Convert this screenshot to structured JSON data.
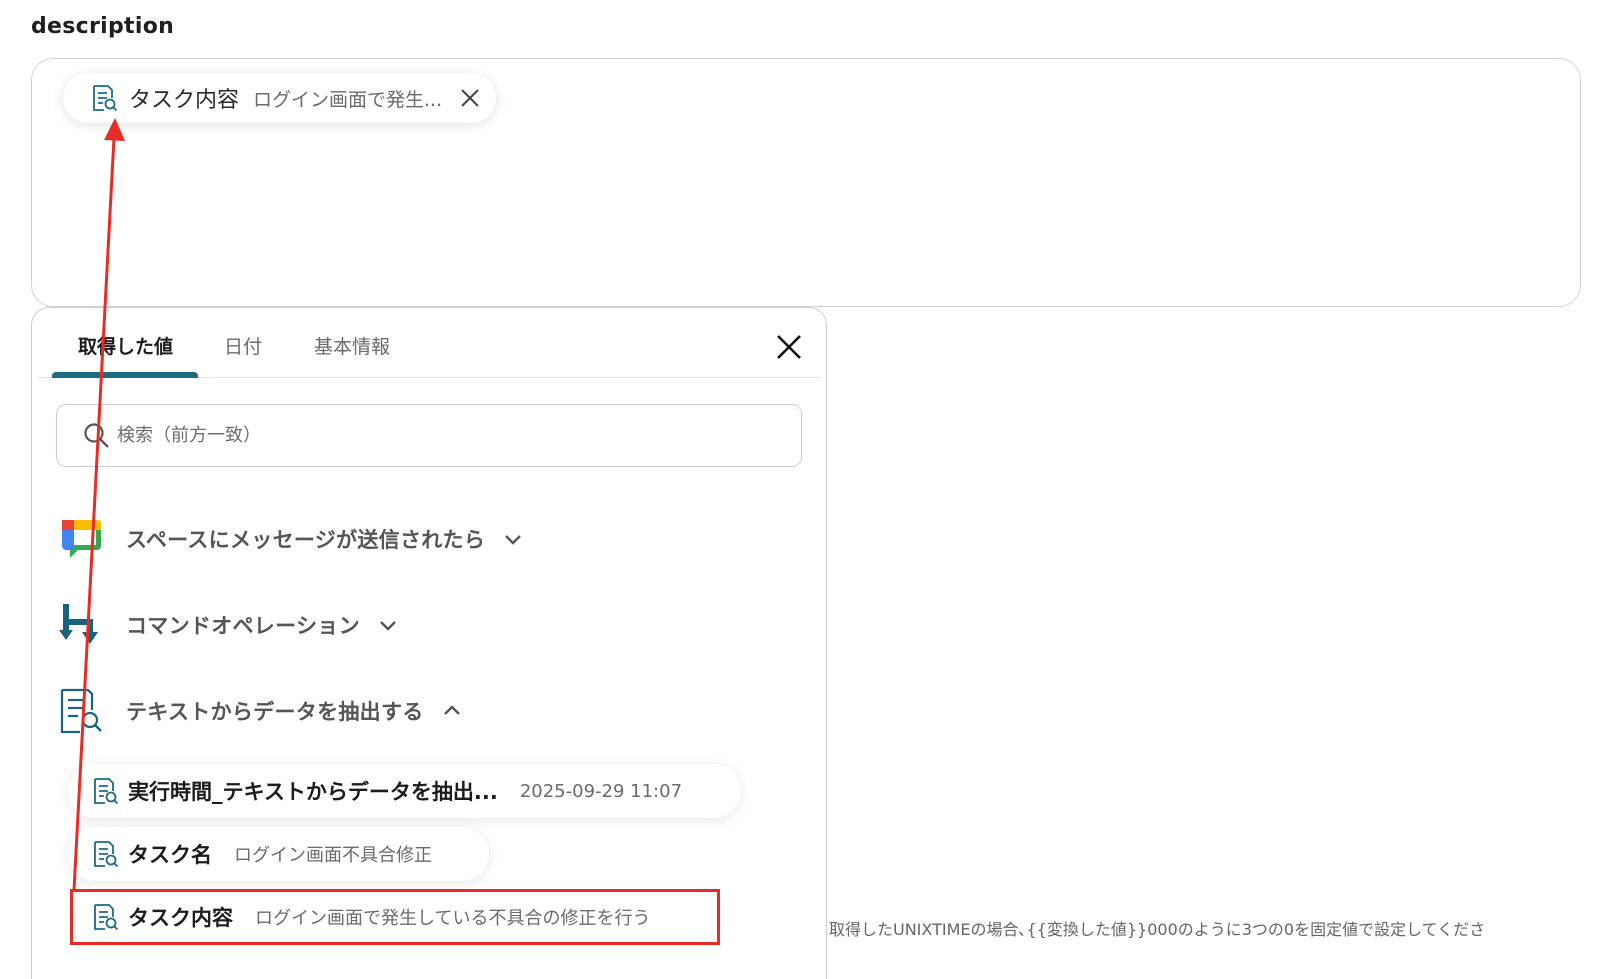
{
  "field": {
    "label": "description"
  },
  "selected_chip": {
    "name": "タスク内容",
    "value": "ログイン画面で発生...",
    "icon": "document-search-icon"
  },
  "picker": {
    "tabs": [
      {
        "label": "取得した値",
        "active": true
      },
      {
        "label": "日付",
        "active": false
      },
      {
        "label": "基本情報",
        "active": false
      }
    ],
    "search_placeholder": "検索（前方一致）",
    "groups": [
      {
        "label": "スペースにメッセージが送信されたら",
        "icon": "google-chat-icon",
        "expanded": false
      },
      {
        "label": "コマンドオペレーション",
        "icon": "command-operation-icon",
        "expanded": false
      },
      {
        "label": "テキストからデータを抽出する",
        "icon": "document-search-icon",
        "expanded": true
      }
    ],
    "items": [
      {
        "name": "実行時間_テキストからデータを抽出...",
        "value": "2025-09-29 11:07"
      },
      {
        "name": "タスク名",
        "value": "ログイン画面不具合修正"
      },
      {
        "name": "タスク内容",
        "value": "ログイン画面で発生している不具合の修正を行う"
      }
    ]
  },
  "hint": "取得したUNIXTIMEの場合､{{変換した値}}000のように3つの0を固定値で設定してくださ",
  "colors": {
    "accent": "#1d6a84",
    "annotation": "#e52d26"
  }
}
